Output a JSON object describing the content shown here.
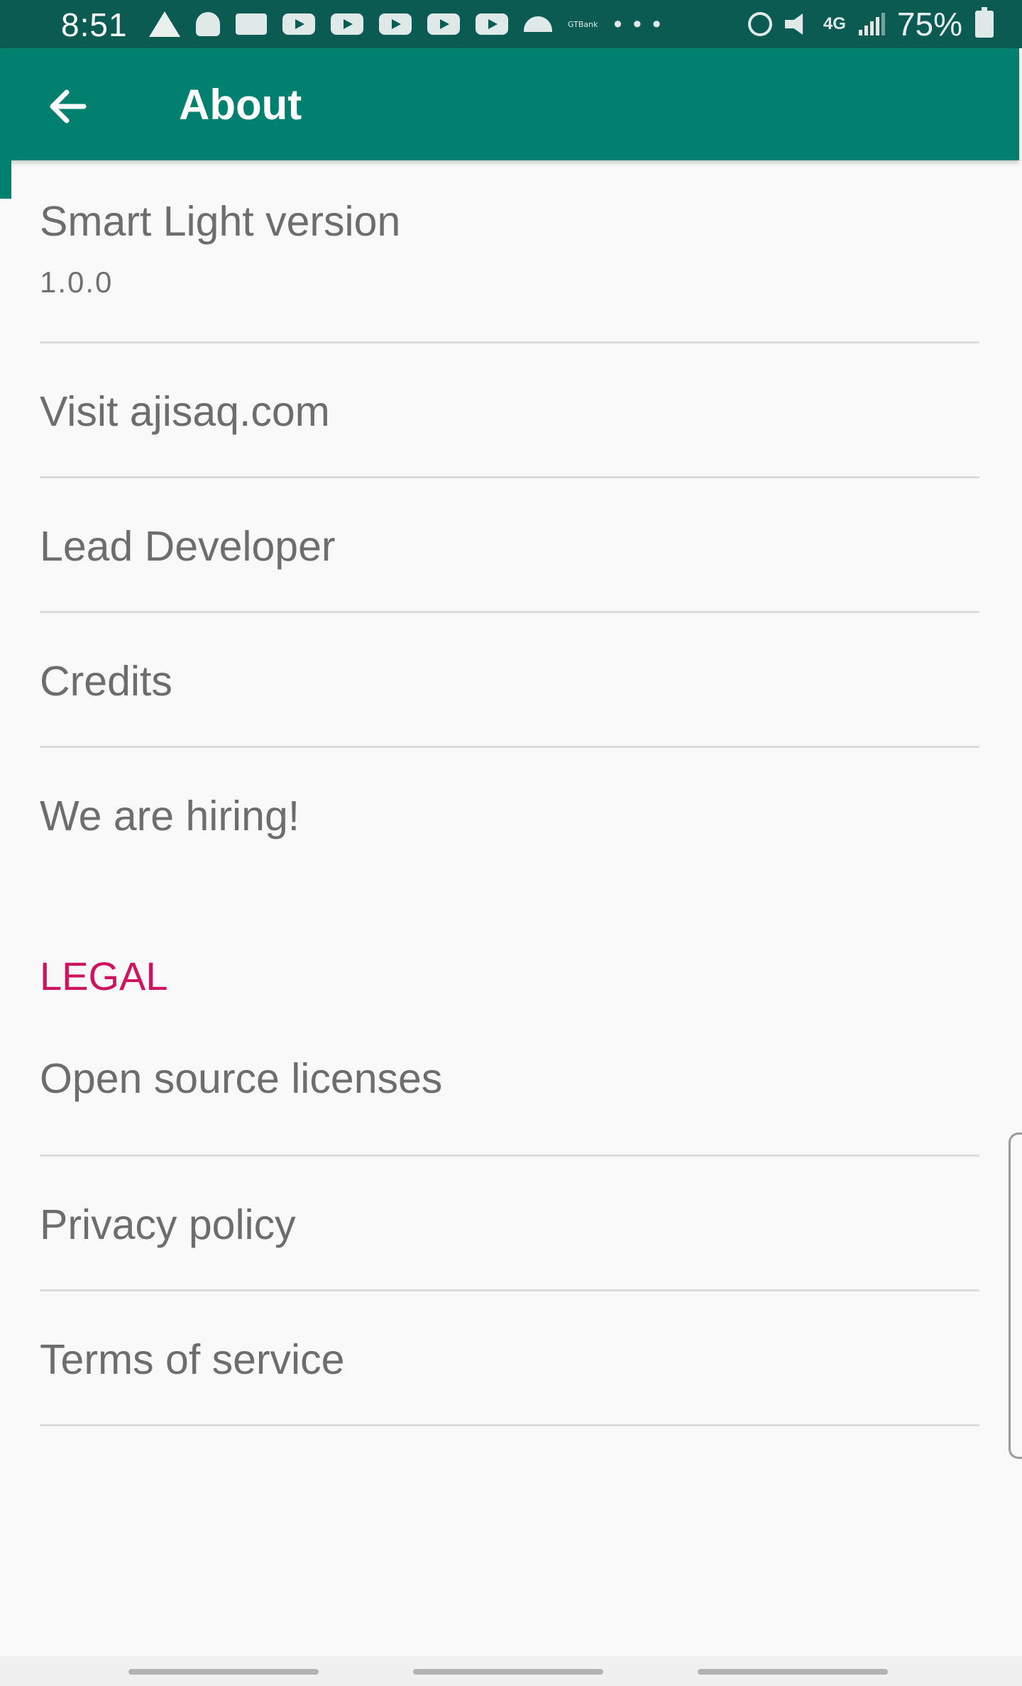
{
  "status_bar": {
    "time": "8:51",
    "notification_icons": [
      "warning-icon",
      "snapchat-icon",
      "chat-icon",
      "youtube-icon",
      "youtube-icon",
      "youtube-icon",
      "youtube-icon",
      "youtube-icon",
      "weather-icon",
      "gtbank-icon",
      "more-dots-icon"
    ],
    "gtbank_label": "GTBank",
    "more_label": "• • •",
    "system_icons": [
      "alarm-icon",
      "mute-icon",
      "data-transfer-icon",
      "signal-icon",
      "battery-charging-icon"
    ],
    "data_label": "4G",
    "battery": "75%"
  },
  "toolbar": {
    "title": "About",
    "back_icon": "arrow-back-icon",
    "background": "#01806f"
  },
  "preferences": {
    "version_title": "Smart Light version",
    "version_value": "1.0.0",
    "visit_website": "Visit ajisaq.com",
    "lead_developer": "Lead Developer",
    "credits": "Credits",
    "hiring": "We are hiring!",
    "legal_header": "LEGAL",
    "open_source": "Open source licenses",
    "privacy_policy": "Privacy policy",
    "terms_of_service": "Terms of service"
  },
  "colors": {
    "status_bar": "#0b5b52",
    "accent": "#d0135e",
    "text": "#6d6d6d",
    "divider": "#dcdcdc",
    "background": "#f9f9f9"
  }
}
